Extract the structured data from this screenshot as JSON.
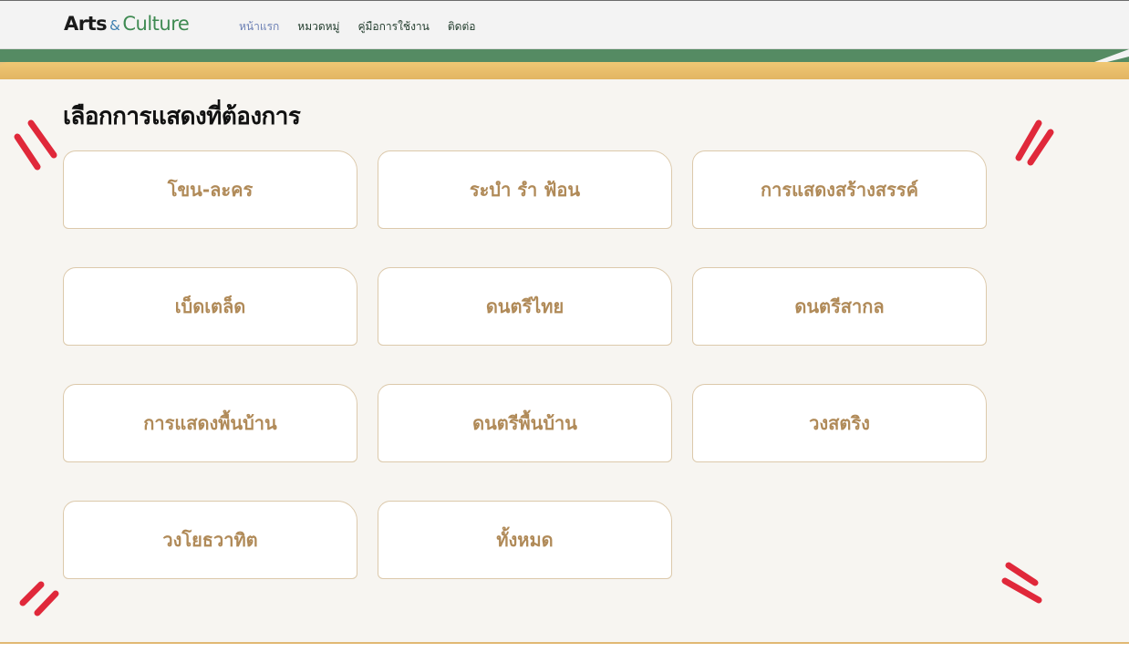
{
  "header": {
    "logo": {
      "part1": "Arts",
      "amp": "&",
      "part2": "Culture"
    },
    "nav": [
      {
        "label": "หน้าแรก",
        "active": true
      },
      {
        "label": "หมวดหมู่",
        "active": false
      },
      {
        "label": "คู่มือการใช้งาน",
        "active": false
      },
      {
        "label": "ติดต่อ",
        "active": false
      }
    ]
  },
  "main": {
    "title": "เลือกการแสดงที่ต้องการ",
    "categories": [
      "โขน-ละคร",
      "ระบำ รำ ฟ้อน",
      "การแสดงสร้างสรรค์",
      "เบ็ดเตล็ด",
      "ดนตรีไทย",
      "ดนตรีสากล",
      "การแสดงพื้นบ้าน",
      "ดนตรีพื้นบ้าน",
      "วงสตริง",
      "วงโยธวาทิต",
      "ทั้งหมด"
    ]
  },
  "colors": {
    "accent_green": "#558b63",
    "accent_gold": "#e2b562",
    "card_text": "#b08a58",
    "deco_red": "#e0283a"
  }
}
